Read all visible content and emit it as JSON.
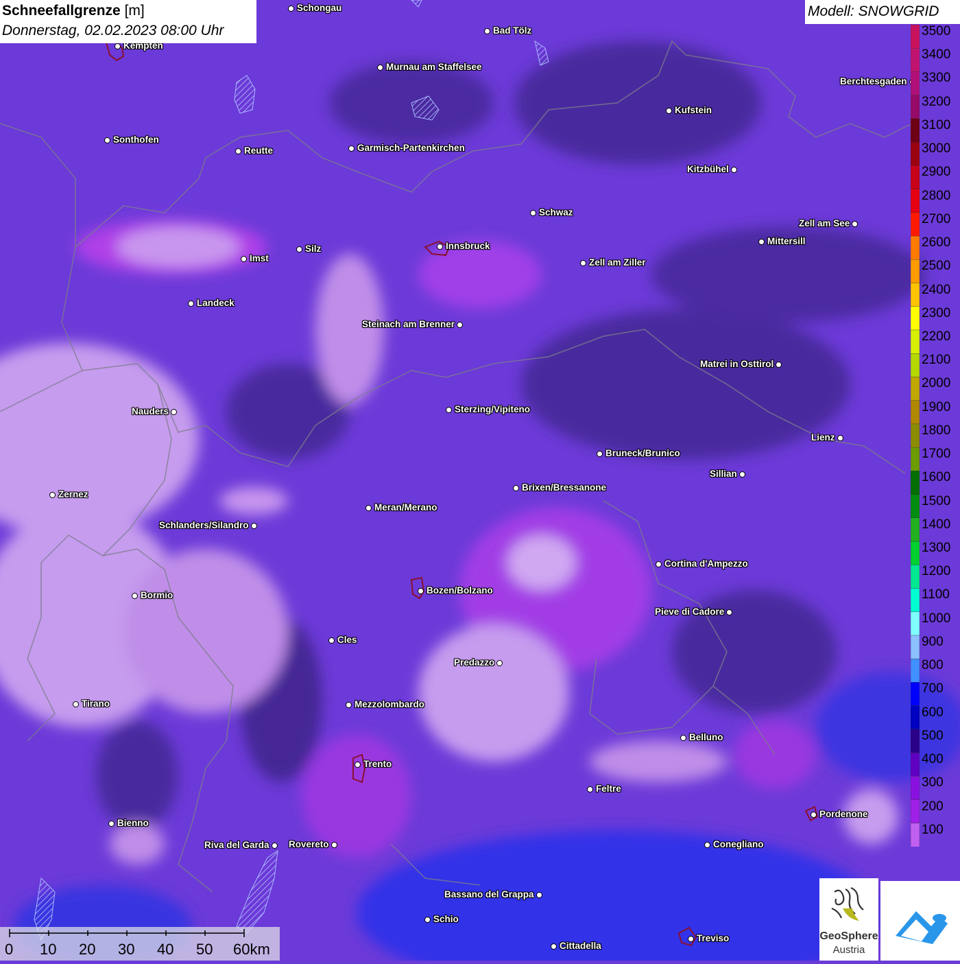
{
  "title": {
    "parameter": "Schneefallgrenze",
    "unit": "[m]",
    "datetime": "Donnerstag, 02.02.2023 08:00 Uhr"
  },
  "model": "Modell: SNOWGRID",
  "legend": {
    "labels": [
      "3500",
      "3400",
      "3300",
      "3200",
      "3100",
      "3000",
      "2900",
      "2800",
      "2700",
      "2600",
      "2500",
      "2400",
      "2300",
      "2200",
      "2100",
      "2000",
      "1900",
      "1800",
      "1700",
      "1600",
      "1500",
      "1400",
      "1300",
      "1200",
      "1100",
      "1000",
      "900",
      "800",
      "700",
      "600",
      "500",
      "400",
      "300",
      "200",
      "100"
    ],
    "colors": [
      "#c8125e",
      "#c01370",
      "#b01078",
      "#960a68",
      "#6e0016",
      "#9a0010",
      "#c8001a",
      "#e60012",
      "#ff1a00",
      "#ff7a00",
      "#ff9c00",
      "#ffc400",
      "#ffff00",
      "#d8f000",
      "#b4d800",
      "#c0a800",
      "#b08800",
      "#8c8c00",
      "#6c9c00",
      "#006e00",
      "#008c10",
      "#20b020",
      "#00d030",
      "#00e890",
      "#00ffd0",
      "#80ffff",
      "#8cc0ff",
      "#4090ff",
      "#0000ff",
      "#0000c0",
      "#2a0088",
      "#6000c0",
      "#8a10e0",
      "#a020e8",
      "#c060f0"
    ]
  },
  "scale": {
    "labels": [
      "0",
      "10",
      "20",
      "30",
      "40",
      "50",
      "60km"
    ]
  },
  "logos": {
    "geosphere_name": "GeoSphere",
    "geosphere_country": "Austria"
  },
  "cities": [
    {
      "name": "Schongau",
      "side": "right"
    },
    {
      "name": "Bad Tölz",
      "side": "right"
    },
    {
      "name": "Kempten",
      "side": "right"
    },
    {
      "name": "Murnau am Staffelsee",
      "side": "right"
    },
    {
      "name": "Berchtesgaden",
      "side": "left"
    },
    {
      "name": "Kufstein",
      "side": "right"
    },
    {
      "name": "Sonthofen",
      "side": "right"
    },
    {
      "name": "Reutte",
      "side": "right"
    },
    {
      "name": "Garmisch-Partenkirchen",
      "side": "right"
    },
    {
      "name": "Kitzbühel",
      "side": "left"
    },
    {
      "name": "Schwaz",
      "side": "right"
    },
    {
      "name": "Zell am See",
      "side": "left"
    },
    {
      "name": "Innsbruck",
      "side": "right"
    },
    {
      "name": "Mittersill",
      "side": "right"
    },
    {
      "name": "Silz",
      "side": "right"
    },
    {
      "name": "Imst",
      "side": "right"
    },
    {
      "name": "Zell am Ziller",
      "side": "right"
    },
    {
      "name": "Landeck",
      "side": "right"
    },
    {
      "name": "Steinach am Brenner",
      "side": "left"
    },
    {
      "name": "Matrei in Osttirol",
      "side": "left"
    },
    {
      "name": "Nauders",
      "side": "left"
    },
    {
      "name": "Sterzing/Vipiteno",
      "side": "right"
    },
    {
      "name": "Lienz",
      "side": "left"
    },
    {
      "name": "Bruneck/Brunico",
      "side": "right"
    },
    {
      "name": "Sillian",
      "side": "left"
    },
    {
      "name": "Brixen/Bressanone",
      "side": "right"
    },
    {
      "name": "Zernez",
      "side": "right"
    },
    {
      "name": "Meran/Merano",
      "side": "right"
    },
    {
      "name": "Schlanders/Silandro",
      "side": "left"
    },
    {
      "name": "Cortina d'Ampezzo",
      "side": "right"
    },
    {
      "name": "Bozen/Bolzano",
      "side": "right"
    },
    {
      "name": "Bormio",
      "side": "right"
    },
    {
      "name": "Pieve di Cadore",
      "side": "left"
    },
    {
      "name": "Cles",
      "side": "right"
    },
    {
      "name": "Predazzo",
      "side": "left"
    },
    {
      "name": "Tirano",
      "side": "right"
    },
    {
      "name": "Mezzolombardo",
      "side": "right"
    },
    {
      "name": "Belluno",
      "side": "right"
    },
    {
      "name": "Trento",
      "side": "right"
    },
    {
      "name": "Feltre",
      "side": "right"
    },
    {
      "name": "Pordenone",
      "side": "right"
    },
    {
      "name": "Bienno",
      "side": "right"
    },
    {
      "name": "Riva del Garda",
      "side": "left"
    },
    {
      "name": "Rovereto",
      "side": "left"
    },
    {
      "name": "Conegliano",
      "side": "right"
    },
    {
      "name": "Bassano del Grappa",
      "side": "left"
    },
    {
      "name": "Schio",
      "side": "right"
    },
    {
      "name": "Treviso",
      "side": "right"
    },
    {
      "name": "Cittadella",
      "side": "right"
    }
  ]
}
